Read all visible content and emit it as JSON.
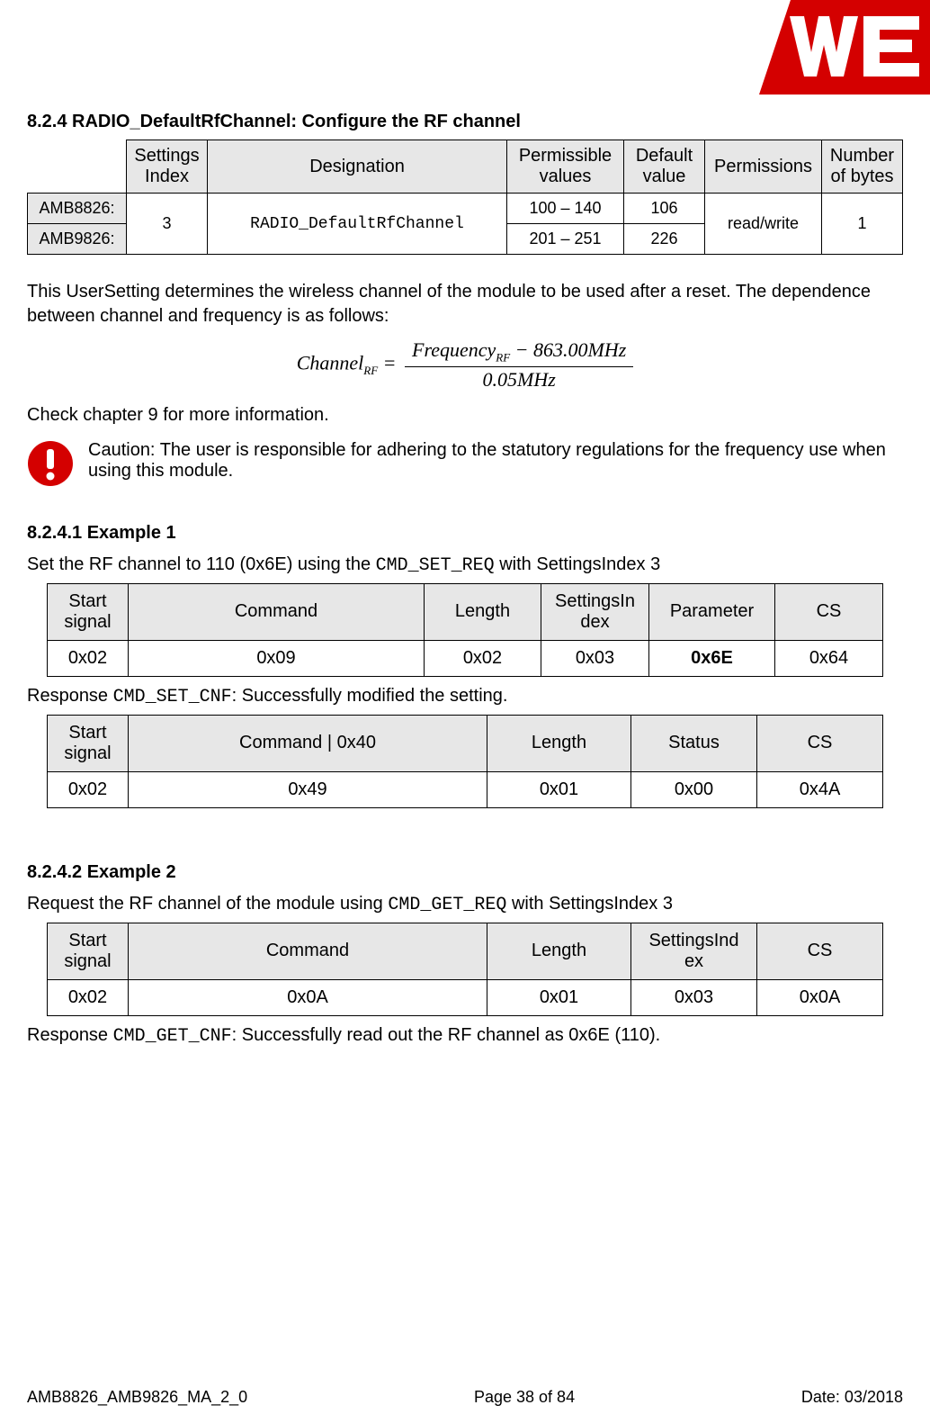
{
  "header": {
    "logo_alt": "WE logo"
  },
  "section": {
    "heading": "8.2.4 RADIO_DefaultRfChannel: Configure the RF channel"
  },
  "table1": {
    "headers": {
      "settings_index": "Settings Index",
      "designation": "Designation",
      "permissible_values": "Permissible values",
      "default_value": "Default value",
      "permissions": "Permissions",
      "number_of_bytes": "Number of bytes"
    },
    "row_labels": {
      "amb8826": "AMB8826:",
      "amb9826": "AMB9826:"
    },
    "settings_index": "3",
    "designation": "RADIO_DefaultRfChannel",
    "permissible": {
      "r1": "100 – 140",
      "r2": "201 – 251"
    },
    "default": {
      "r1": "106",
      "r2": "226"
    },
    "permissions": "read/write",
    "num_bytes": "1"
  },
  "text": {
    "intro": "This UserSetting determines the wireless channel of the module to be used after a reset. The dependence between channel and frequency is as follows:",
    "check_chapter": "Check chapter 9 for more information.",
    "caution": "Caution: The user is responsible for adhering to the statutory regulations for the frequency use when using this module."
  },
  "formula": {
    "lhs_channel": "Channel",
    "rf_sub": "RF",
    "equals": " = ",
    "num_frequency": "Frequency",
    "num_minus": " − 863.00",
    "mhz": "MHz",
    "den_value": "0.05",
    "den_mhz": "MHz"
  },
  "example1": {
    "heading": "8.2.4.1   Example 1",
    "intro_a": "Set the RF channel to 110 (0x6E) using the ",
    "intro_cmd": "CMD_SET_REQ",
    "intro_b": " with SettingsIndex 3",
    "tableA": {
      "headers": {
        "start": "Start signal",
        "command": "Command",
        "length": "Length",
        "settings_index": "SettingsIn\ndex",
        "parameter": "Parameter",
        "cs": "CS"
      },
      "row": {
        "start": "0x02",
        "command": "0x09",
        "length": "0x02",
        "settings_index": "0x03",
        "parameter": "0x6E",
        "cs": "0x64"
      }
    },
    "response_a": "Response ",
    "response_cmd": "CMD_SET_CNF",
    "response_b": ": Successfully modified the setting.",
    "tableB": {
      "headers": {
        "start": "Start signal",
        "command": "Command | 0x40",
        "length": "Length",
        "status": "Status",
        "cs": "CS"
      },
      "row": {
        "start": "0x02",
        "command": "0x49",
        "length": "0x01",
        "status": "0x00",
        "cs": "0x4A"
      }
    }
  },
  "example2": {
    "heading": "8.2.4.2   Example 2",
    "intro_a": "Request the RF channel of the module using  ",
    "intro_cmd": "CMD_GET_REQ",
    "intro_b": " with SettingsIndex 3",
    "tableA": {
      "headers": {
        "start": "Start signal",
        "command": "Command",
        "length": "Length",
        "settings_index": "SettingsInd\nex",
        "cs": "CS"
      },
      "row": {
        "start": "0x02",
        "command": "0x0A",
        "length": "0x01",
        "settings_index": "0x03",
        "cs": "0x0A"
      }
    },
    "response_a": "Response ",
    "response_cmd": "CMD_GET_CNF",
    "response_b": ": Successfully read out the RF channel as 0x6E (110)."
  },
  "footer": {
    "left": "AMB8826_AMB9826_MA_2_0",
    "center": "Page 38 of 84",
    "right": "Date: 03/2018"
  }
}
